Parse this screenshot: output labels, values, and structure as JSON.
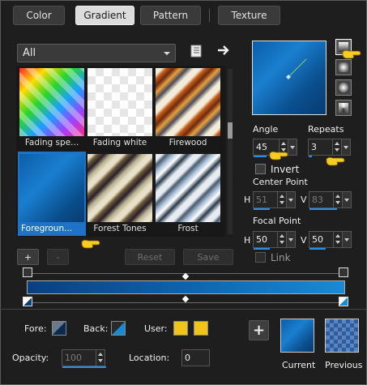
{
  "tabs": [
    {
      "label": "Color",
      "active": false
    },
    {
      "label": "Gradient",
      "active": true
    },
    {
      "label": "Pattern",
      "active": false
    },
    {
      "label": "Texture",
      "active": false
    }
  ],
  "category": {
    "value": "All"
  },
  "gradients": [
    {
      "name": "Fading spe...",
      "selected": false
    },
    {
      "name": "Fading white",
      "selected": false
    },
    {
      "name": "Firewood",
      "selected": false
    },
    {
      "name": "Foregroun...",
      "selected": true
    },
    {
      "name": "Forest Tones",
      "selected": false
    },
    {
      "name": "Frost",
      "selected": false
    }
  ],
  "grid_buttons": {
    "add": "+",
    "remove": "-",
    "reset": "Reset",
    "save": "Save"
  },
  "angle": {
    "label": "Angle",
    "value": "45"
  },
  "repeats": {
    "label": "Repeats",
    "value": "3"
  },
  "invert": {
    "label": "Invert",
    "checked": false
  },
  "center_point": {
    "label": "Center Point",
    "h_label": "H",
    "h": "51",
    "v_label": "V",
    "v": "83"
  },
  "focal_point": {
    "label": "Focal Point",
    "h_label": "H",
    "h": "50",
    "v_label": "V",
    "v": "50"
  },
  "link": {
    "label": "Link",
    "checked": false
  },
  "bottom": {
    "fore_label": "Fore:",
    "back_label": "Back:",
    "user_label": "User:",
    "opacity_label": "Opacity:",
    "opacity": "100",
    "location_label": "Location:",
    "location": "0",
    "add": "+",
    "current_label": "Current",
    "previous_label": "Previous"
  },
  "colors": {
    "accent": "#1e73c8",
    "gradient_start": "#0a3f80",
    "gradient_end": "#1a8ad6",
    "user_swatch": "#f2c31a",
    "pointer": "#f5cc1f"
  },
  "icons": {
    "library": "book-icon",
    "forward": "arrow-right-icon",
    "add": "plus-icon",
    "pointer": "hand-pointer-icon"
  }
}
